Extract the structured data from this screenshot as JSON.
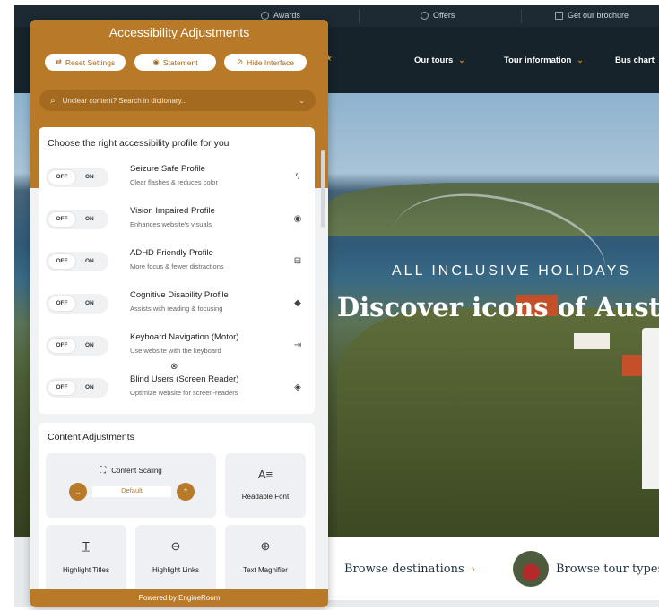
{
  "site": {
    "topbar": [
      "Awards",
      "Offers",
      "Get our brochure"
    ],
    "nav": [
      "Our tours",
      "Tour information",
      "Bus chart"
    ],
    "hero_kicker": "ALL INCLUSIVE HOLIDAYS",
    "hero_headline": "Discover icons of Austr",
    "browse_destinations": "Browse destinations",
    "browse_tour_types": "Browse tour types"
  },
  "panel": {
    "title": "Accessibility Adjustments",
    "buttons": {
      "reset": "Reset Settings",
      "statement": "Statement",
      "hide": "Hide Interface"
    },
    "search_placeholder": "Unclear content? Search in dictionary...",
    "profiles_heading": "Choose the right accessibility profile for you",
    "toggle_off": "OFF",
    "toggle_on": "ON",
    "profiles": [
      {
        "name": "Seizure Safe Profile",
        "desc": "Clear flashes & reduces color",
        "icon": "bolt-icon"
      },
      {
        "name": "Vision Impaired Profile",
        "desc": "Enhances website's visuals",
        "icon": "eye-icon"
      },
      {
        "name": "ADHD Friendly Profile",
        "desc": "More focus & fewer distractions",
        "icon": "focus-frame-icon"
      },
      {
        "name": "Cognitive Disability Profile",
        "desc": "Assists with reading & focusing",
        "icon": "diamond-icon"
      },
      {
        "name": "Keyboard Navigation (Motor)",
        "desc": "Use website with the keyboard",
        "icon": "arrow-right-bar-icon"
      },
      {
        "name": "Blind Users (Screen Reader)",
        "desc": "Optimize website for screen-readers",
        "icon": "audio-icon"
      }
    ],
    "content_heading": "Content Adjustments",
    "content_scaling": {
      "label": "Content Scaling",
      "value": "Default"
    },
    "tiles": [
      "Readable Font",
      "Highlight Titles",
      "Highlight Links",
      "Text Magnifier"
    ],
    "footer": "Powered by EngineRoom"
  },
  "colors": {
    "accent": "#b87a28",
    "nav_bg": "#17232b",
    "panel_bg": "#f1f2f4"
  }
}
